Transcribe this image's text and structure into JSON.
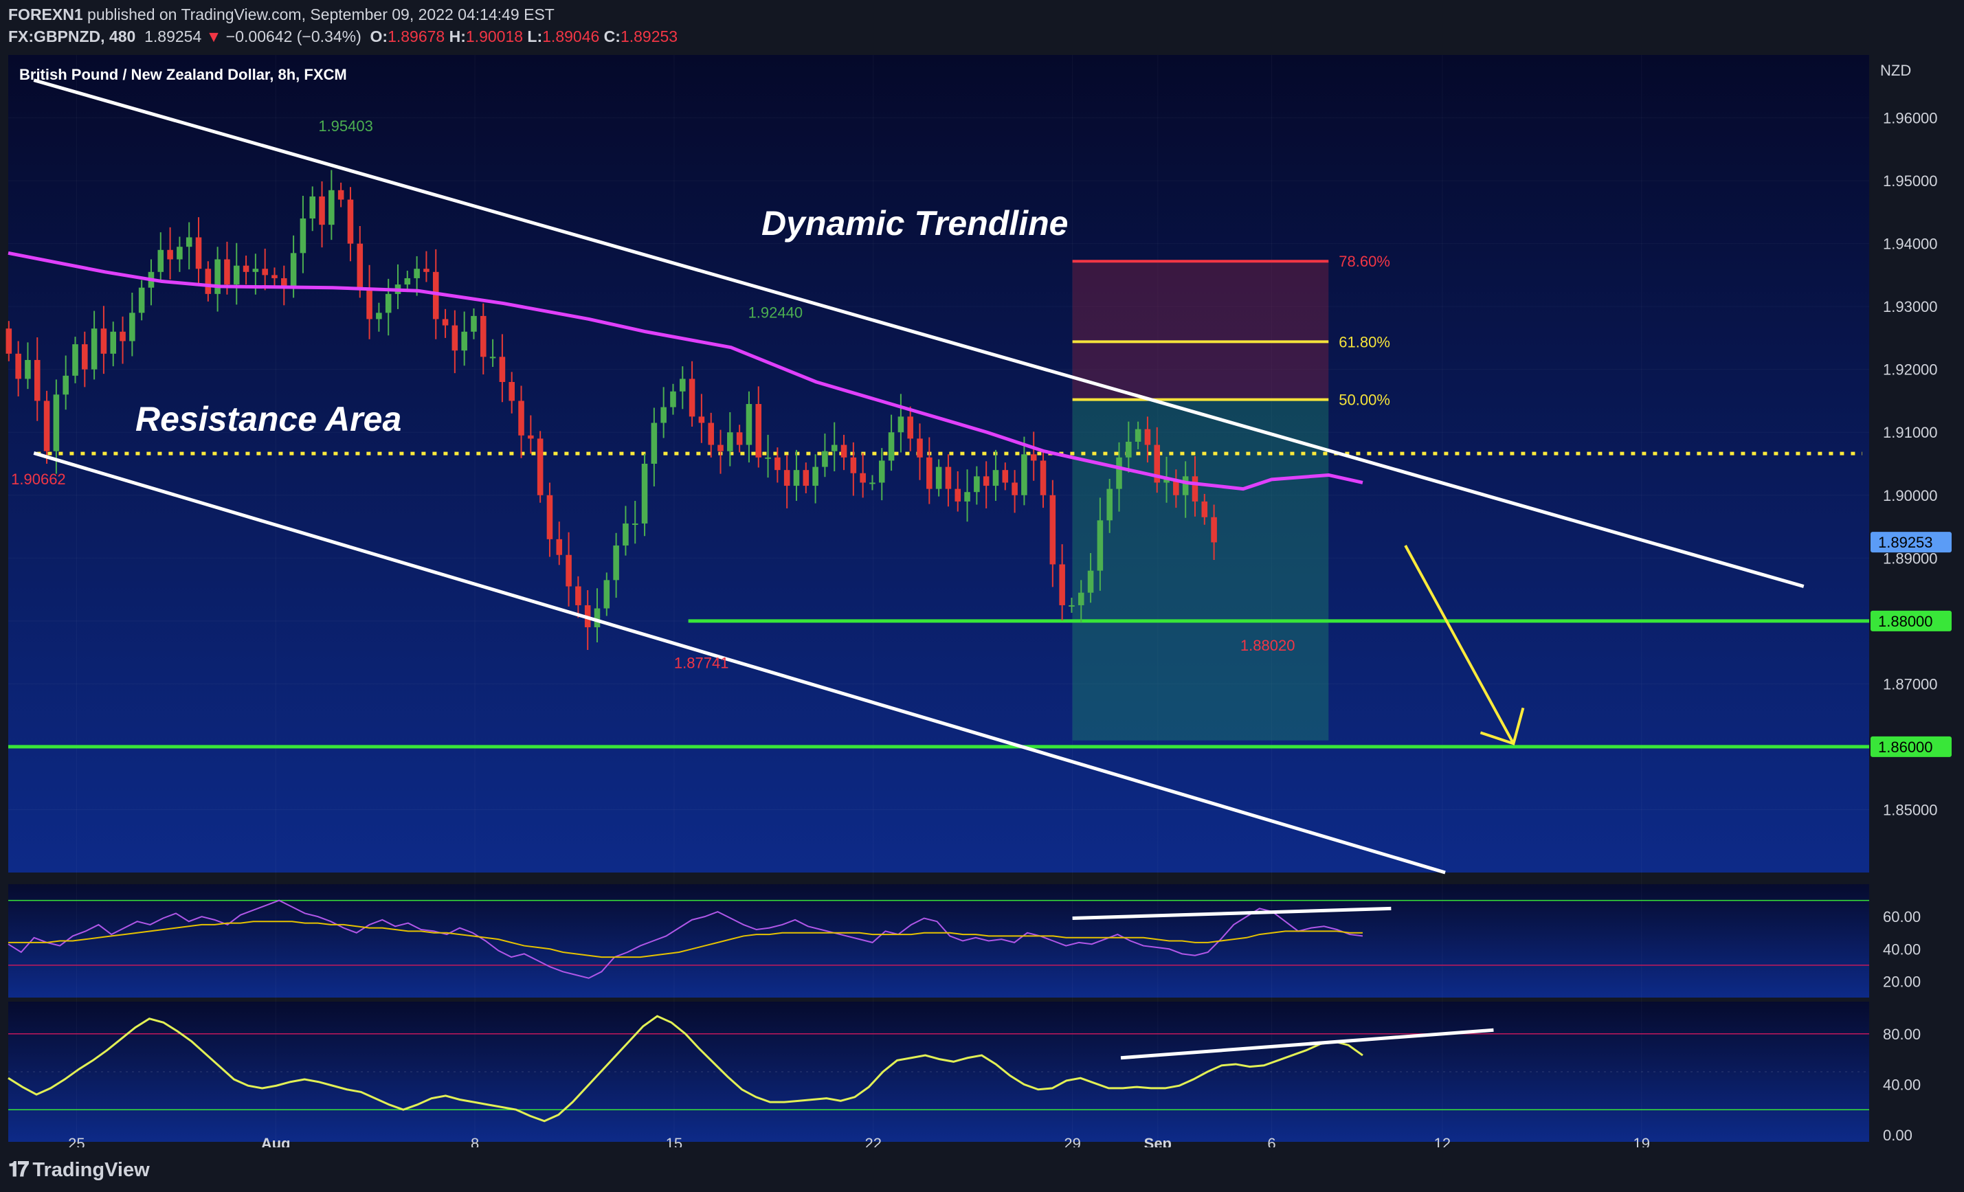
{
  "header": {
    "publisher": "FOREXN1",
    "published_text": "published on TradingView.com, September 09, 2022 04:14:49 EST",
    "symbol": "FX:GBPNZD, 480",
    "last": "1.89254",
    "change": "−0.00642 (−0.34%)",
    "o_label": "O:",
    "o_val": "1.89678",
    "h_label": "H:",
    "h_val": "1.90018",
    "l_label": "L:",
    "l_val": "1.89046",
    "c_label": "C:",
    "c_val": "1.89253"
  },
  "chart_title": "British Pound / New Zealand Dollar, 8h, FXCM",
  "currency": "NZD",
  "annotations": {
    "dynamic_trendline": "Dynamic Trendline",
    "resistance_area": "Resistance Area",
    "fib_786": "78.60%",
    "fib_618": "61.80%",
    "fib_500": "50.00%"
  },
  "colors": {
    "background_top": "#05092a",
    "background_bottom": "#0d2a88",
    "up": "#4caf50",
    "down": "#e53935",
    "ema": "#e040fb",
    "support": "#39e639",
    "resistance_dots": "#ffeb3b",
    "trendline": "#ffffff",
    "price_tag": "#5b9cf6"
  },
  "chart_data": [
    {
      "type": "candlestick",
      "title": "British Pound / New Zealand Dollar, 8h, FXCM",
      "yunit": "NZD",
      "ylim": [
        1.84,
        1.97
      ],
      "yticks": [
        "1.85000",
        "1.86000",
        "1.87000",
        "1.88000",
        "1.89000",
        "1.90000",
        "1.91000",
        "1.92000",
        "1.93000",
        "1.94000",
        "1.95000",
        "1.96000"
      ],
      "xticks": [
        {
          "label": "25",
          "day": 25
        },
        {
          "label": "Aug",
          "day": 32
        },
        {
          "label": "8",
          "day": 39
        },
        {
          "label": "15",
          "day": 46
        },
        {
          "label": "22",
          "day": 53
        },
        {
          "label": "29",
          "day": 60
        },
        {
          "label": "Sep",
          "day": 63
        },
        {
          "label": "6",
          "day": 67
        },
        {
          "label": "12",
          "day": 73
        },
        {
          "label": "19",
          "day": 80
        }
      ],
      "day_range": [
        22.6,
        88
      ],
      "candles_start_day": 22.62,
      "candle_step_day": 0.3335,
      "closes": [
        1.9225,
        1.9185,
        1.9215,
        1.915,
        1.907,
        1.916,
        1.919,
        1.924,
        1.92,
        1.9265,
        1.9225,
        1.926,
        1.9245,
        1.929,
        1.933,
        1.9355,
        1.939,
        1.9375,
        1.9395,
        1.941,
        1.936,
        1.932,
        1.9375,
        1.9335,
        1.9365,
        1.9355,
        1.936,
        1.935,
        1.9345,
        1.933,
        1.9385,
        1.944,
        1.9475,
        1.943,
        1.9485,
        1.947,
        1.94,
        1.933,
        1.928,
        1.929,
        1.932,
        1.9335,
        1.9345,
        1.936,
        1.9355,
        1.928,
        1.927,
        1.923,
        1.926,
        1.9285,
        1.922,
        1.922,
        1.918,
        1.915,
        1.9095,
        1.909,
        1.9,
        1.893,
        1.8905,
        1.8855,
        1.8825,
        1.879,
        1.882,
        1.8865,
        1.892,
        1.8955,
        1.8955,
        1.905,
        1.9115,
        1.914,
        1.9165,
        1.9185,
        1.9125,
        1.9115,
        1.908,
        1.907,
        1.91,
        1.908,
        1.9145,
        1.906,
        1.906,
        1.904,
        1.9015,
        1.904,
        1.9015,
        1.9045,
        1.907,
        1.908,
        1.906,
        1.9035,
        1.902,
        1.902,
        1.9055,
        1.91,
        1.9125,
        1.909,
        1.906,
        1.901,
        1.9045,
        1.901,
        1.899,
        1.9005,
        1.903,
        1.9015,
        1.904,
        1.902,
        1.9,
        1.9065,
        1.9055,
        1.9,
        1.889,
        1.8825,
        1.8825,
        1.8845,
        1.888,
        1.896,
        1.901,
        1.906,
        1.9085,
        1.9105,
        1.908,
        1.902,
        1.9025,
        1.9,
        1.903,
        1.899,
        1.8965,
        1.8925
      ],
      "labels": [
        {
          "text": "1.95403",
          "day": 33.5,
          "price": 1.95403,
          "color": "#4caf50"
        },
        {
          "text": "1.92440",
          "day": 48.6,
          "price": 1.9244,
          "color": "#4caf50"
        },
        {
          "text": "1.90662",
          "day": 22.7,
          "price": 1.90662,
          "color": "#f23645"
        },
        {
          "text": "1.87741",
          "day": 46.0,
          "price": 1.87741,
          "color": "#f23645"
        },
        {
          "text": "1.88020",
          "day": 65.9,
          "price": 1.8802,
          "color": "#f23645"
        }
      ],
      "price_tags": [
        {
          "text": "1.89253",
          "price": 1.89253,
          "color": "#5b9cf6"
        },
        {
          "text": "1.88000",
          "price": 1.88,
          "color": "#39e639"
        },
        {
          "text": "1.86000",
          "price": 1.86,
          "color": "#39e639"
        }
      ],
      "support_levels": [
        {
          "price": 1.88,
          "from_day": 46.5
        },
        {
          "price": 1.86,
          "from_day": 22.6
        }
      ],
      "resistance_level": {
        "price": 1.90662,
        "from_day": 23.6
      },
      "channel_upper": [
        [
          23.5,
          1.966
        ],
        [
          85.7,
          1.8855
        ]
      ],
      "channel_lower": [
        [
          23.5,
          1.9067
        ],
        [
          73.1,
          1.84
        ]
      ],
      "projection_arrow": [
        [
          71.7,
          1.892
        ],
        [
          75.5,
          1.8605
        ]
      ],
      "ema": [
        [
          22.6,
          1.9385
        ],
        [
          26,
          1.9355
        ],
        [
          28,
          1.934
        ],
        [
          30,
          1.9332
        ],
        [
          34,
          1.933
        ],
        [
          37,
          1.9325
        ],
        [
          40,
          1.9305
        ],
        [
          43,
          1.928
        ],
        [
          45,
          1.926
        ],
        [
          48,
          1.9235
        ],
        [
          51,
          1.918
        ],
        [
          54,
          1.914
        ],
        [
          57,
          1.91
        ],
        [
          59,
          1.907
        ],
        [
          61,
          1.905
        ],
        [
          63,
          1.903
        ],
        [
          64,
          1.902
        ],
        [
          66,
          1.901
        ],
        [
          67,
          1.9025
        ],
        [
          69,
          1.9032
        ],
        [
          70.2,
          1.902
        ]
      ],
      "fib_zone": {
        "from_day": 60.0,
        "to_day": 69.0,
        "p786": 1.9372,
        "p618": 1.9244,
        "p500": 1.9152,
        "bottom": 1.861
      }
    },
    {
      "type": "line",
      "title": "",
      "ylim": [
        10,
        80
      ],
      "yticks": [
        "20.00",
        "40.00",
        "60.00"
      ],
      "bands": [
        30,
        70
      ],
      "series": [
        {
          "color": "#b057e8",
          "values": [
            43,
            38,
            47,
            44,
            42,
            48,
            51,
            55,
            49,
            53,
            57,
            55,
            59,
            62,
            57,
            60,
            58,
            55,
            61,
            64,
            67,
            70,
            66,
            62,
            60,
            57,
            53,
            50,
            55,
            58,
            54,
            56,
            52,
            51,
            49,
            53,
            50,
            45,
            39,
            35,
            37,
            33,
            29,
            26,
            24,
            22,
            26,
            35,
            38,
            42,
            45,
            48,
            53,
            58,
            60,
            63,
            59,
            55,
            52,
            53,
            55,
            58,
            54,
            52,
            50,
            48,
            46,
            44,
            51,
            49,
            55,
            59,
            57,
            48,
            45,
            47,
            45,
            46,
            44,
            50,
            48,
            45,
            42,
            44,
            43,
            46,
            49,
            45,
            42,
            41,
            40,
            37,
            36,
            38,
            46,
            55,
            60,
            65,
            63,
            57,
            51,
            53,
            54,
            52,
            49,
            48
          ]
        },
        {
          "color": "#e6c200",
          "values": [
            44,
            44,
            44,
            44,
            45,
            45,
            46,
            47,
            48,
            49,
            50,
            51,
            52,
            53,
            54,
            55,
            55,
            56,
            56,
            57,
            57,
            57,
            57,
            56,
            56,
            55,
            55,
            54,
            53,
            53,
            52,
            51,
            51,
            50,
            50,
            49,
            48,
            47,
            46,
            44,
            42,
            41,
            40,
            38,
            37,
            36,
            35,
            35,
            35,
            35,
            36,
            37,
            38,
            40,
            42,
            44,
            46,
            48,
            49,
            49,
            50,
            50,
            50,
            50,
            50,
            50,
            50,
            49,
            49,
            49,
            49,
            50,
            50,
            50,
            49,
            49,
            48,
            48,
            48,
            48,
            48,
            48,
            47,
            47,
            47,
            47,
            47,
            47,
            47,
            46,
            45,
            45,
            44,
            44,
            45,
            46,
            47,
            49,
            50,
            51,
            51,
            51,
            51,
            51,
            50,
            50
          ]
        }
      ],
      "trend": [
        [
          60.0,
          59
        ],
        [
          71.2,
          65
        ]
      ]
    },
    {
      "type": "line",
      "title": "",
      "ylim": [
        0,
        100
      ],
      "yticks": [
        "0.00",
        "40.00",
        "80.00"
      ],
      "bands": [
        20,
        80
      ],
      "series": [
        {
          "color": "#e2f055",
          "values": [
            45,
            38,
            32,
            37,
            44,
            52,
            59,
            67,
            76,
            85,
            92,
            89,
            82,
            74,
            64,
            54,
            44,
            39,
            37,
            39,
            42,
            44,
            42,
            39,
            36,
            34,
            29,
            24,
            20,
            24,
            29,
            31,
            28,
            26,
            24,
            22,
            20,
            15,
            11,
            16,
            26,
            38,
            50,
            62,
            74,
            86,
            94,
            89,
            80,
            68,
            57,
            46,
            36,
            30,
            26,
            26,
            27,
            28,
            29,
            27,
            30,
            38,
            50,
            59,
            61,
            63,
            60,
            58,
            61,
            63,
            56,
            47,
            40,
            36,
            37,
            43,
            45,
            41,
            37,
            37,
            38,
            37,
            37,
            39,
            44,
            50,
            55,
            56,
            54,
            55,
            59,
            63,
            67,
            72,
            74,
            71,
            63
          ]
        }
      ],
      "trend": [
        [
          61.7,
          61
        ],
        [
          74.8,
          83
        ]
      ]
    }
  ],
  "footer": {
    "logo_text": "TradingView"
  }
}
